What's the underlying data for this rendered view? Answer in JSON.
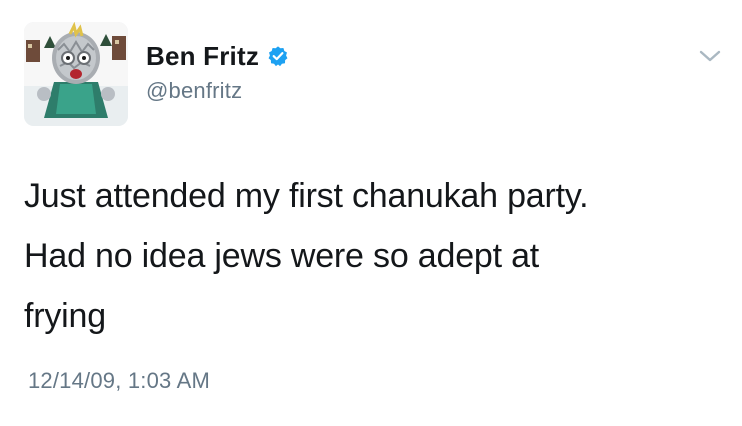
{
  "author": {
    "display_name": "Ben Fritz",
    "handle": "@benfritz",
    "verified": true,
    "avatar_icon": "cartoon-character-avatar-icon",
    "verified_icon": "verified-badge-icon"
  },
  "tweet": {
    "text": "Just attended my first chanukah party.\nHad no idea jews were so adept at\nfrying",
    "timestamp": "12/14/09, 1:03 AM"
  },
  "menu": {
    "caret_icon": "chevron-down-icon"
  },
  "colors": {
    "text_primary": "#14171a",
    "text_secondary": "#657786",
    "verified_blue": "#1da1f2",
    "caret_gray": "#aab8c2"
  }
}
